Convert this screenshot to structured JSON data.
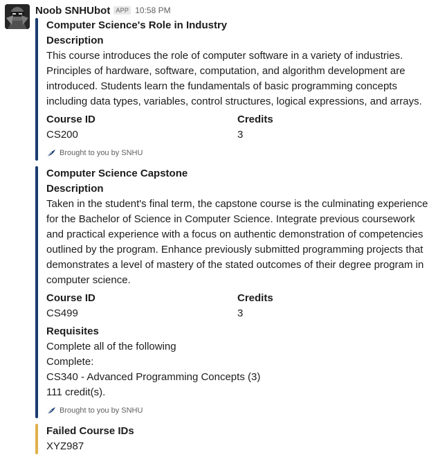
{
  "message": {
    "bot_name": "Noob SNHUbot",
    "app_badge": "APP",
    "time": "10:58 PM",
    "avatar_icon": "ninja-avatar"
  },
  "attachments": [
    {
      "color": "#1a3b6e",
      "title": "Computer Science's Role in Industry",
      "description_label": "Description",
      "description": "This course introduces the role of computer software in a variety of industries. Principles of hardware, software, computation, and algorithm development are introduced. Students learn the fundamentals of basic programming concepts including data types, variables, control structures, logical expressions, and arrays.",
      "course_id_label": "Course ID",
      "course_id": "CS200",
      "credits_label": "Credits",
      "credits": "3",
      "footer": "Brought to you by SNHU",
      "footer_icon": "feather-icon"
    },
    {
      "color": "#1a3b6e",
      "title": "Computer Science Capstone",
      "description_label": "Description",
      "description": "Taken in the student's final term, the capstone course is the culminating experience for the Bachelor of Science in Computer Science. Integrate previous coursework and practical experience with a focus on authentic demonstration of competencies outlined by the program. Enhance previously submitted programming projects that demonstrates a level of mastery of the stated outcomes of their degree program in computer science.",
      "course_id_label": "Course ID",
      "course_id": "CS499",
      "credits_label": "Credits",
      "credits": "3",
      "requisites_label": "Requisites",
      "requisites": [
        "Complete all of the following",
        "Complete:",
        "CS340 - Advanced Programming Concepts (3)",
        "111 credit(s)."
      ],
      "footer": "Brought to you by SNHU",
      "footer_icon": "feather-icon"
    },
    {
      "color": "#e0b04a",
      "title": "Failed Course IDs",
      "value": "XYZ987"
    }
  ]
}
